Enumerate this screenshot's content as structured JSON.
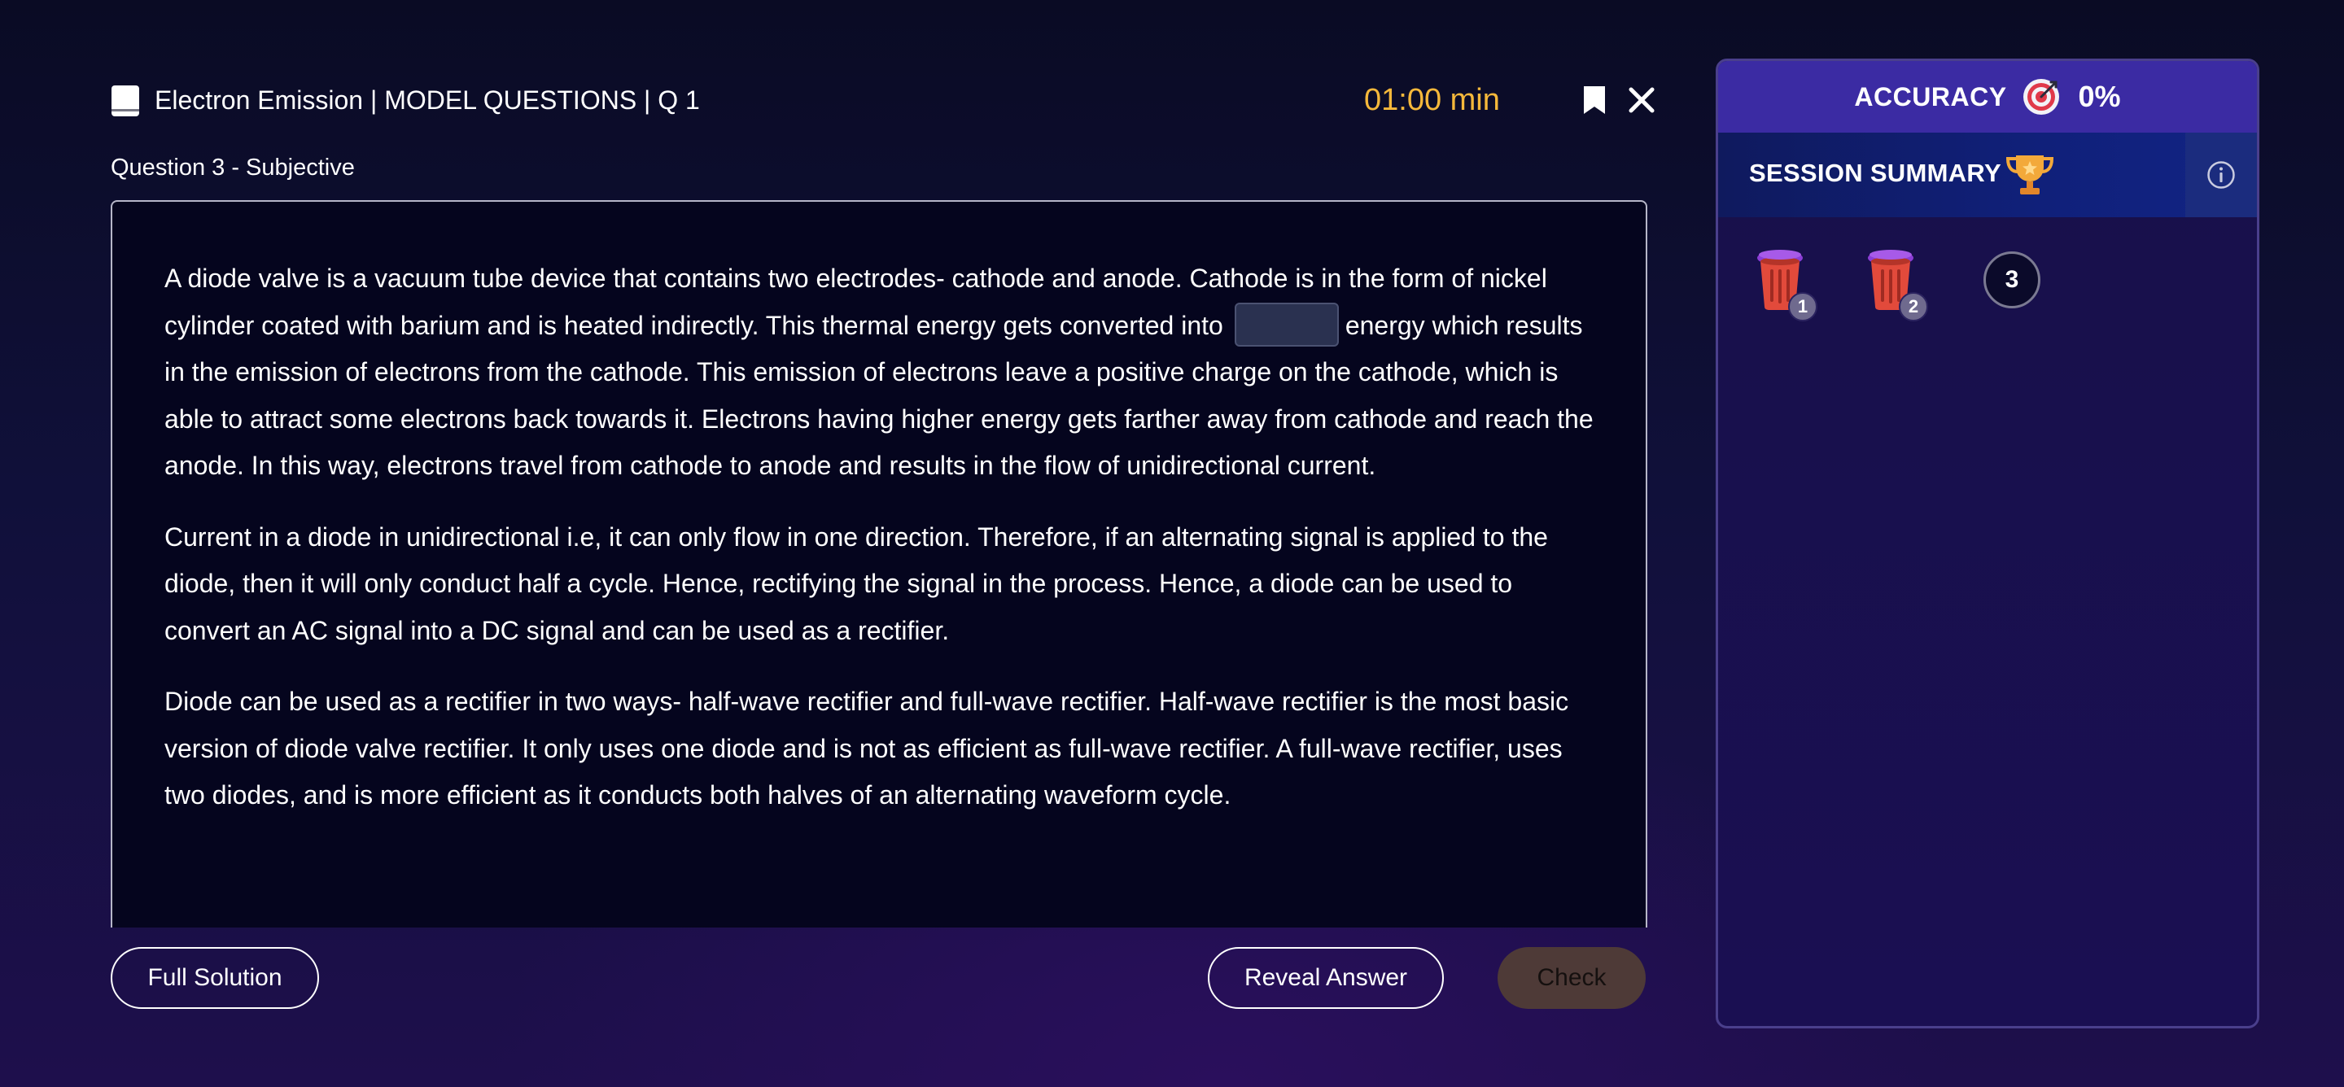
{
  "header": {
    "title": "Electron Emission | MODEL QUESTIONS | Q 1",
    "timer": "01:00 min",
    "icons": {
      "book": "book-icon",
      "bookmark": "bookmark-icon",
      "close": "close-icon"
    }
  },
  "question": {
    "subtitle": "Question 3 - Subjective",
    "para1_before_blank": "A diode valve is a vacuum tube device that contains two electrodes- cathode and anode. Cathode is in the form of nickel cylinder coated with barium and is heated indirectly. This thermal energy gets converted into",
    "blank_value": "",
    "para1_after_blank": "energy which results in the emission of electrons from the cathode. This emission of electrons leave a positive charge on the cathode, which is able to attract some electrons back towards it. Electrons having higher energy gets farther away from cathode and reach the anode. In this way, electrons travel from cathode to anode and results in the flow of unidirectional current.",
    "para2": "Current in a diode in unidirectional i.e, it can only flow in one direction. Therefore, if an alternating signal is applied to the diode, then it will only conduct half a cycle. Hence, rectifying the signal in the process. Hence, a diode can be used to convert an AC signal into a DC signal and can be used as a rectifier.",
    "para3": "Diode can be used as a rectifier in two ways- half-wave rectifier and full-wave rectifier. Half-wave rectifier is the most basic version of diode valve rectifier. It only uses one diode and is not as efficient as full-wave rectifier. A full-wave rectifier, uses two diodes, and is more efficient as it conducts both halves of an alternating waveform cycle."
  },
  "actions": {
    "full_solution": "Full Solution",
    "reveal_answer": "Reveal Answer",
    "check": "Check"
  },
  "sidebar": {
    "accuracy_label": "ACCURACY",
    "accuracy_value": "0%",
    "summary_label": "SESSION SUMMARY",
    "attempts": [
      {
        "number": "1",
        "status": "wrong",
        "icon": "bin-icon"
      },
      {
        "number": "2",
        "status": "wrong",
        "icon": "bin-icon"
      },
      {
        "number": "3",
        "status": "current"
      }
    ]
  },
  "colors": {
    "timer": "#f5b83b",
    "accuracy_bar": "#3b2ba3",
    "check_button": "#4e3a37"
  }
}
